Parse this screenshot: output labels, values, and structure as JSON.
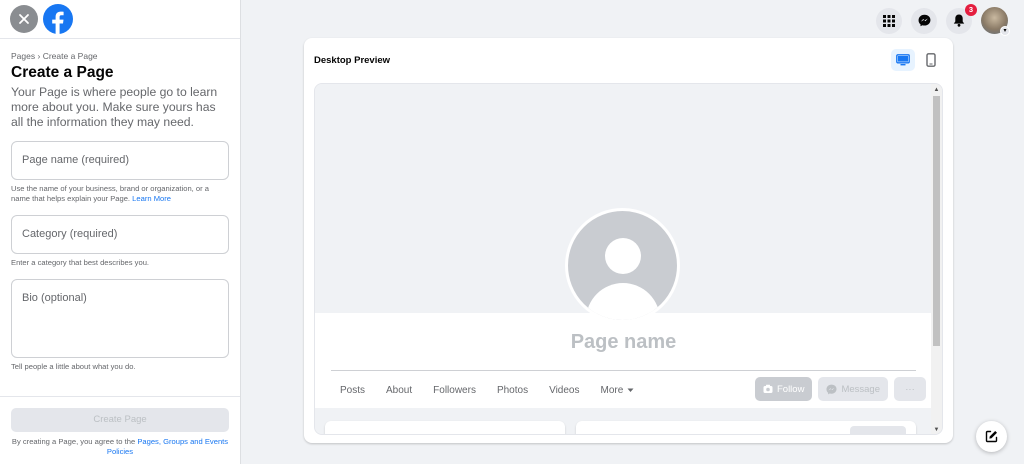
{
  "left_panel": {
    "breadcrumb_root": "Pages",
    "breadcrumb_sep": "›",
    "breadcrumb_current": "Create a Page",
    "title": "Create a Page",
    "subtitle": "Your Page is where people go to learn more about you. Make sure yours has all the information they may need.",
    "page_name_placeholder": "Page name (required)",
    "page_name_help": "Use the name of your business, brand or organization, or a name that helps explain your Page.",
    "learn_more": "Learn More",
    "category_placeholder": "Category (required)",
    "category_help": "Enter a category that best describes you.",
    "bio_placeholder": "Bio (optional)",
    "bio_help": "Tell people a little about what you do.",
    "create_button": "Create Page",
    "terms_prefix": "By creating a Page, you agree to the",
    "terms_link": "Pages, Groups and Events Policies"
  },
  "topbar": {
    "notifications_count": "3"
  },
  "preview": {
    "title": "Desktop Preview",
    "page_name": "Page name",
    "tabs": [
      "Posts",
      "About",
      "Followers",
      "Photos",
      "Videos",
      "More"
    ],
    "follow_label": "Follow",
    "message_label": "Message",
    "more_actions": "···"
  },
  "colors": {
    "brand": "#1877f2",
    "badge": "#e41e3f",
    "disabled": "#bcc0c4"
  }
}
